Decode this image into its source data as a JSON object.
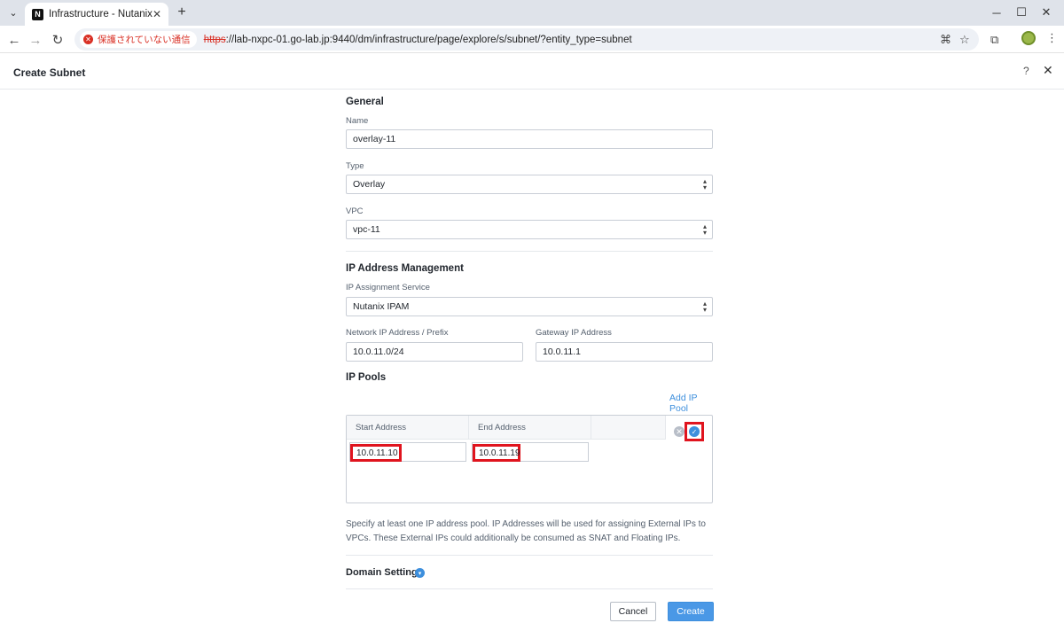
{
  "browser": {
    "tab_title": "Infrastructure - Nutanix",
    "tab_favicon": "N",
    "insecure_label": "保護されていない通信",
    "url_scheme": "https",
    "url_rest": "://lab-nxpc-01.go-lab.jp:9440/dm/infrastructure/page/explore/s/subnet/?entity_type=subnet"
  },
  "header": {
    "title": "Create Subnet",
    "help": "?",
    "close": "✕"
  },
  "general": {
    "title": "General",
    "name_label": "Name",
    "name_value": "overlay-11",
    "type_label": "Type",
    "type_value": "Overlay",
    "vpc_label": "VPC",
    "vpc_value": "vpc-11"
  },
  "ipam": {
    "title": "IP Address Management",
    "service_label": "IP Assignment Service",
    "service_value": "Nutanix IPAM",
    "network_label": "Network IP Address / Prefix",
    "network_value": "10.0.11.0/24",
    "gateway_label": "Gateway IP Address",
    "gateway_value": "10.0.11.1"
  },
  "ip_pools": {
    "title": "IP Pools",
    "add_link": "Add IP Pool",
    "start_header": "Start Address",
    "end_header": "End Address",
    "start_value": "10.0.11.10",
    "end_value": "10.0.11.19",
    "help_text": "Specify at least one IP address pool. IP Addresses will be used for assigning External IPs to VPCs. These External IPs could additionally be consumed as SNAT and Floating IPs."
  },
  "domain": {
    "title": "Domain Settings"
  },
  "footer": {
    "cancel_label": "Cancel",
    "create_label": "Create"
  },
  "colors": {
    "accent": "#3d8fdd",
    "highlight_box": "#e0141e",
    "insecure_red": "#d93025"
  }
}
